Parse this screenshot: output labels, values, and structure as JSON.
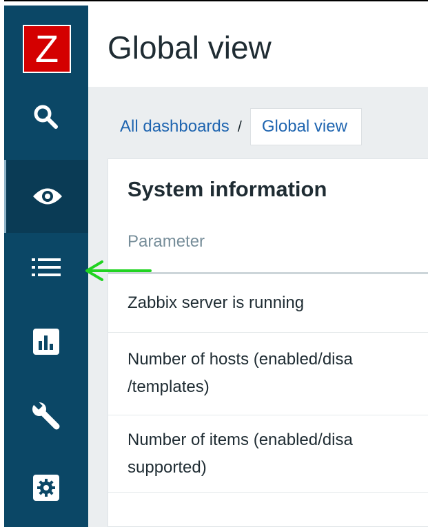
{
  "app": {
    "logo_letter": "Z"
  },
  "sidebar": {
    "items": [
      {
        "name": "search",
        "icon": "search-icon"
      },
      {
        "name": "monitoring",
        "icon": "eye-icon",
        "active": true
      },
      {
        "name": "inventory",
        "icon": "list-icon"
      },
      {
        "name": "reports",
        "icon": "bar-chart-icon"
      },
      {
        "name": "configuration",
        "icon": "wrench-icon"
      },
      {
        "name": "administration",
        "icon": "gear-icon"
      }
    ]
  },
  "header": {
    "title": "Global view"
  },
  "breadcrumb": {
    "all_dashboards": "All dashboards",
    "separator": "/",
    "current": "Global view"
  },
  "widget": {
    "title": "System information",
    "column_header": "Parameter",
    "rows": [
      "Zabbix server is running",
      "Number of hosts (enabled/disa\n/templates)",
      "Number of items (enabled/disa\nsupported)"
    ]
  },
  "colors": {
    "sidebar": "#0b4766",
    "logo": "#d40000",
    "link": "#1f65b0",
    "annotation_arrow": "#21d321"
  }
}
